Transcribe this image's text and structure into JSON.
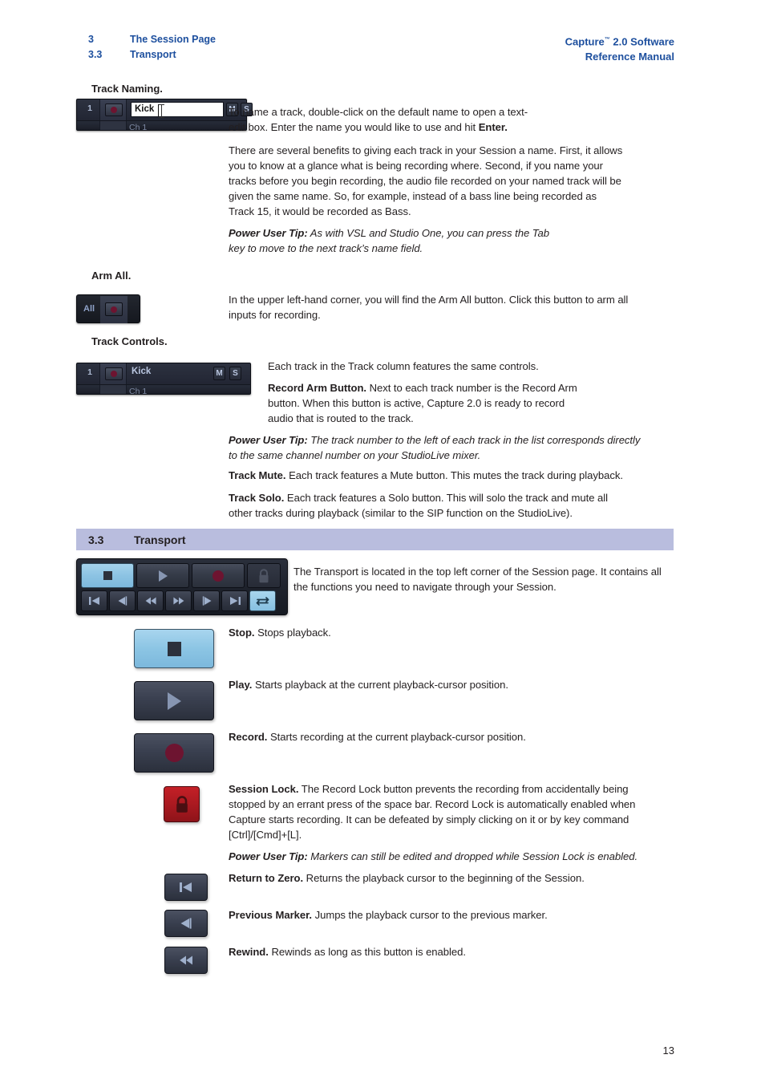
{
  "header": {
    "left": [
      {
        "num": "3",
        "text": "The Session Page"
      },
      {
        "num": "3.3",
        "text": "Transport"
      }
    ],
    "right_line1_pre": "Capture",
    "right_line1_tm": "™",
    "right_line1_post": " 2.0 Software",
    "right_line2": "Reference Manual",
    "accent_color": "#1d4f9e"
  },
  "section_labels": {
    "track_naming": "Track Naming.",
    "arm_all": "Arm All.",
    "track_controls": "Track Controls."
  },
  "track_strip_naming": {
    "number": "1",
    "name_value": "Kick",
    "channel": "Ch 1",
    "mute": "M",
    "solo": "S"
  },
  "track_strip_controls": {
    "number": "1",
    "name_value": "Kick",
    "channel": "Ch 1",
    "mute": "M",
    "solo": "S"
  },
  "arm_all_widget": {
    "label": "All",
    "icon": "record-dot-icon"
  },
  "paragraphs": {
    "naming_intro_l1": "To name a track, double-click on the default name to open a text-",
    "naming_intro_l2_a": "edit box. Enter the name you would like to use and hit ",
    "naming_intro_l2_b": "Enter.",
    "naming_body": "There are several benefits to giving each track in your Session a name. First, it allows you to know at a glance what is being recording where. Second, if you name your tracks before you begin recording, the audio file recorded on your named track will be given the same name. So, for example, instead of a bass line being recorded as Track 15, it would be recorded as Bass.",
    "naming_tip_label": "Power User Tip:",
    "naming_tip_text": " As with VSL and Studio One, you can press the Tab key to move to the next track’s name field.",
    "armall_body": "In the upper left-hand corner, you will find the Arm All button. Click this button to arm all inputs for recording.",
    "controls_intro": "Each track in the Track column features the same controls.",
    "record_arm_label": "Record Arm Button.",
    "record_arm_text": " Next to each track number is the Record Arm button. When this button is active, Capture 2.0 is ready to record audio that is routed to the track.",
    "controls_tip_label": "Power User Tip:",
    "controls_tip_text": " The track number to the left of each track in the list corresponds directly to the same channel number on your StudioLive mixer.",
    "track_mute_label": "Track Mute.",
    "track_mute_text": " Each track features a Mute button. This mutes the track during playback.",
    "track_solo_label": "Track Solo.",
    "track_solo_text": " Each track features a Solo button. This will solo the track and mute all other tracks during playback (similar to the SIP function on the StudioLive).",
    "transport_body": "The Transport is located in the top left corner of the Session page. It contains all the functions you need to navigate through your Session.",
    "lock_tip_label": "Power User Tip:",
    "lock_tip_text": " Markers can still be edited and dropped while Session Lock is enabled."
  },
  "section_bar": {
    "number": "3.3",
    "title": "Transport",
    "bg_color": "#b9bdde"
  },
  "transport_panel": {
    "big_buttons": [
      {
        "name": "stop-button",
        "icon": "stop-icon",
        "state": "active"
      },
      {
        "name": "play-button",
        "icon": "play-icon",
        "state": "normal"
      },
      {
        "name": "record-button",
        "icon": "record-icon",
        "state": "normal"
      },
      {
        "name": "session-lock-button",
        "icon": "lock-icon",
        "state": "disabled"
      }
    ],
    "small_buttons": [
      {
        "name": "return-to-zero-button",
        "icon": "skip-back-icon",
        "state": "normal"
      },
      {
        "name": "previous-marker-button",
        "icon": "prev-marker-icon",
        "state": "normal"
      },
      {
        "name": "rewind-button",
        "icon": "rewind-icon",
        "state": "normal"
      },
      {
        "name": "fast-forward-button",
        "icon": "fast-forward-icon",
        "state": "normal"
      },
      {
        "name": "next-marker-button",
        "icon": "next-marker-icon",
        "state": "normal"
      },
      {
        "name": "go-to-end-button",
        "icon": "skip-forward-icon",
        "state": "normal"
      },
      {
        "name": "loop-button",
        "icon": "loop-icon",
        "state": "active"
      }
    ]
  },
  "transport_rows": [
    {
      "button": "stop-button",
      "icon": "stop-icon",
      "style": "blue-wide",
      "title": "Stop.",
      "text": " Stops playback."
    },
    {
      "button": "play-button",
      "icon": "play-icon",
      "style": "dark-wide",
      "title": "Play.",
      "text": " Starts playback at the current playback-cursor position."
    },
    {
      "button": "record-button",
      "icon": "record-icon",
      "style": "dark-wide",
      "title": "Record.",
      "text": " Starts recording at the current playback-cursor position."
    },
    {
      "button": "session-lock-button",
      "icon": "lock-icon",
      "style": "red-square",
      "title": "Session Lock.",
      "text": " The Record Lock button prevents the recording from accidentally being stopped by an errant press of the space bar. Record Lock is automatically enabled when Capture starts recording. It can be defeated by simply clicking on it or by key command [Ctrl]/[Cmd]+[L]."
    },
    {
      "button": "return-to-zero-button",
      "icon": "skip-back-icon",
      "style": "dark-nav",
      "title": "Return to Zero.",
      "text": " Returns the playback cursor to the beginning of the Session."
    },
    {
      "button": "previous-marker-button",
      "icon": "prev-marker-icon",
      "style": "dark-nav",
      "title": "Previous Marker.",
      "text": " Jumps the playback cursor to the previous marker."
    },
    {
      "button": "rewind-button",
      "icon": "rewind-icon",
      "style": "dark-nav",
      "title": "Rewind.",
      "text": " Rewinds as long as this button is enabled."
    }
  ],
  "page_number": "13"
}
